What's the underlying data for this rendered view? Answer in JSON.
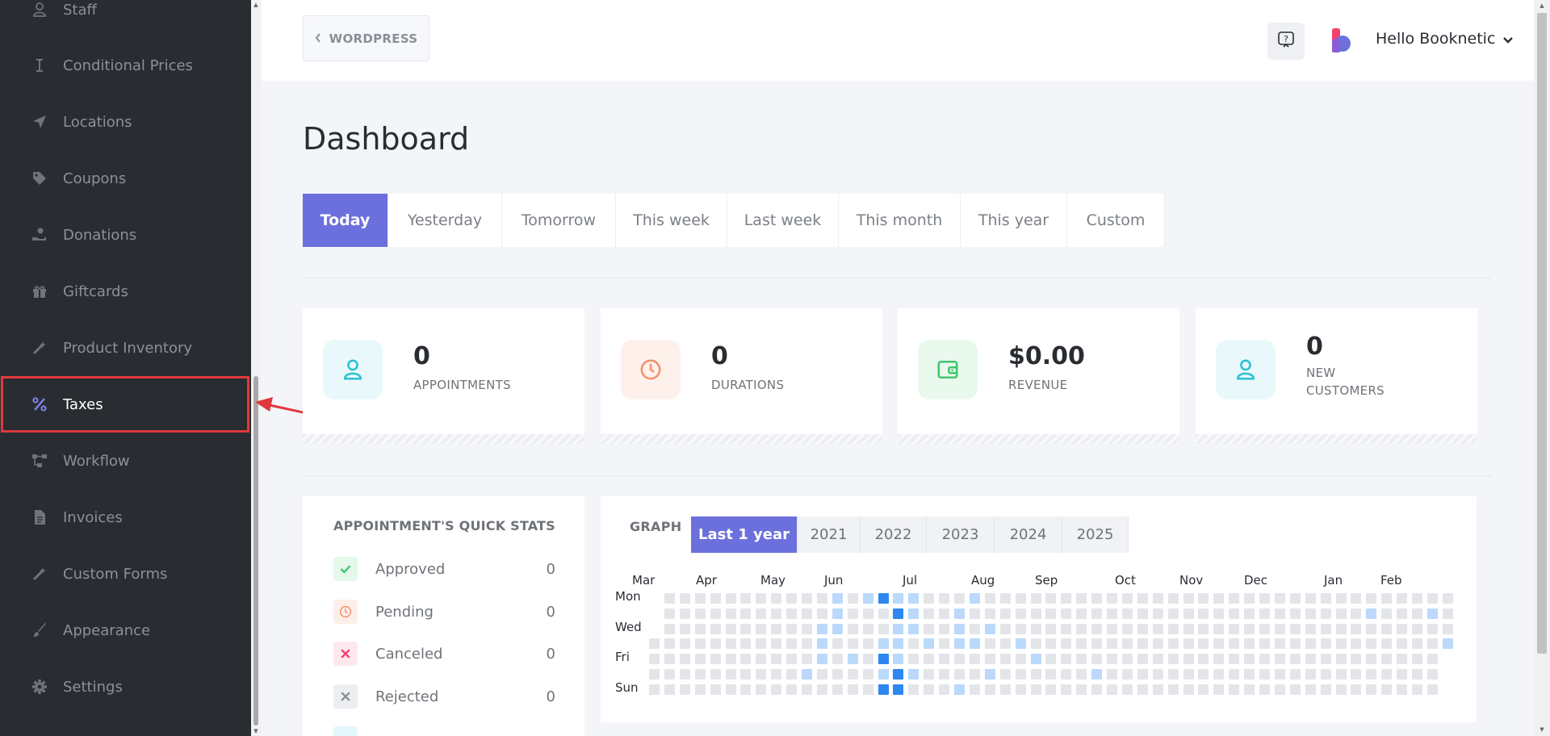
{
  "sidebar": {
    "items": [
      {
        "label": "Staff",
        "icon": "user-icon"
      },
      {
        "label": "Conditional Prices",
        "icon": "i-beam-icon"
      },
      {
        "label": "Locations",
        "icon": "location-arrow-icon"
      },
      {
        "label": "Coupons",
        "icon": "tag-icon"
      },
      {
        "label": "Donations",
        "icon": "hand-donation-icon"
      },
      {
        "label": "Giftcards",
        "icon": "gift-icon"
      },
      {
        "label": "Product Inventory",
        "icon": "magic-wand-icon"
      },
      {
        "label": "Taxes",
        "icon": "percent-icon",
        "active": true
      },
      {
        "label": "Workflow",
        "icon": "workflow-icon"
      },
      {
        "label": "Invoices",
        "icon": "file-icon"
      },
      {
        "label": "Custom Forms",
        "icon": "magic-wand-icon"
      },
      {
        "label": "Appearance",
        "icon": "brush-icon"
      },
      {
        "label": "Settings",
        "icon": "gear-icon"
      }
    ]
  },
  "header": {
    "back_label": "WORDPRESS",
    "user_label": "Hello Booknetic"
  },
  "page_title": "Dashboard",
  "tabs": [
    "Today",
    "Yesterday",
    "Tomorrow",
    "This week",
    "Last week",
    "This month",
    "This year",
    "Custom"
  ],
  "active_tab": "Today",
  "stats": [
    {
      "value": "0",
      "label": "APPOINTMENTS",
      "icon": "user-icon",
      "color": "#2bc0d4",
      "bg": "#e9f9fb"
    },
    {
      "value": "0",
      "label": "DURATIONS",
      "icon": "clock-icon",
      "color": "#f3906b",
      "bg": "#fef1ec"
    },
    {
      "value": "$0.00",
      "label": "REVENUE",
      "icon": "wallet-icon",
      "color": "#3fc76a",
      "bg": "#e9f9ee"
    },
    {
      "value": "0",
      "label": "NEW\nCUSTOMERS",
      "icon": "user-icon",
      "color": "#2bc0d4",
      "bg": "#e9f9fb"
    }
  ],
  "quick_stats": {
    "title": "APPOINTMENT'S QUICK STATS",
    "rows": [
      {
        "label": "Approved",
        "count": "0",
        "icon": "check-icon",
        "color": "#3fc76a",
        "bg": "#e6f8ec"
      },
      {
        "label": "Pending",
        "count": "0",
        "icon": "clock-icon",
        "color": "#f3906b",
        "bg": "#fdeee8"
      },
      {
        "label": "Canceled",
        "count": "0",
        "icon": "close-icon",
        "color": "#f43f6d",
        "bg": "#fde8ee"
      },
      {
        "label": "Rejected",
        "count": "0",
        "icon": "close-icon",
        "color": "#8a8e96",
        "bg": "#eceef2"
      }
    ]
  },
  "graph": {
    "title": "GRAPH",
    "year_tabs": [
      "Last 1 year",
      "2021",
      "2022",
      "2023",
      "2024",
      "2025"
    ],
    "active_year": "Last 1 year",
    "months": [
      "Mar",
      "Apr",
      "May",
      "Jun",
      "Jul",
      "Aug",
      "Sep",
      "Oct",
      "Nov",
      "Dec",
      "Jan",
      "Feb"
    ],
    "days": [
      "Mon",
      "Wed",
      "Fri",
      "Sun"
    ],
    "colors": {
      "empty": "#e4e5e8",
      "light": "#bad9fb",
      "dark": "#2e86f0"
    }
  }
}
